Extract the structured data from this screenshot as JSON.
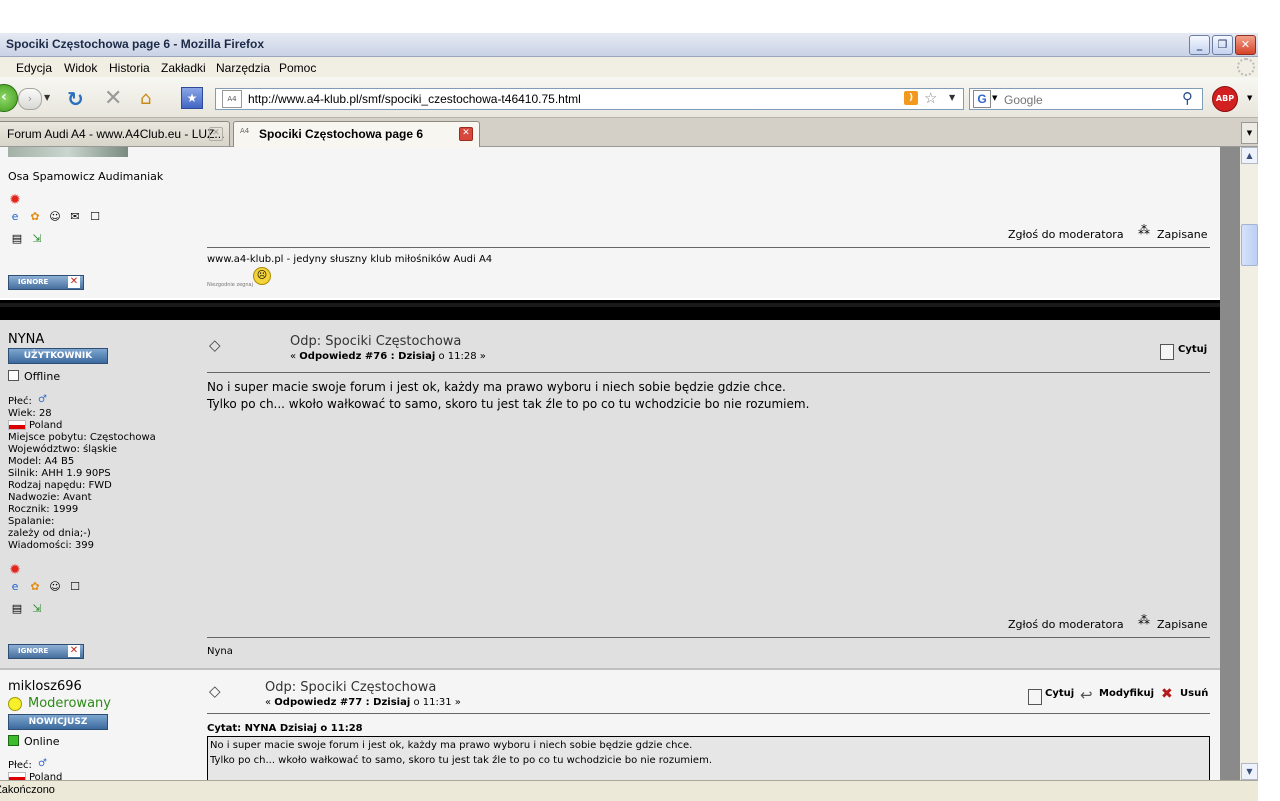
{
  "window": {
    "title": "Spociki Częstochowa page 6 - Mozilla Firefox",
    "min_icon": "_",
    "max_icon": "❐",
    "close_icon": "✕"
  },
  "menu": [
    "Edycja",
    "Widok",
    "Historia",
    "Zakładki",
    "Narzędzia",
    "Pomoc"
  ],
  "nav": {
    "url": "http://www.a4-klub.pl/smf/spociki_czestochowa-t46410.75.html",
    "site_icon_text": "A4",
    "search_engine": "G",
    "search_placeholder": "Google",
    "adblock": "ABP"
  },
  "tabs": [
    {
      "label": "Forum Audi A4 - www.A4Club.eu - LUZ...",
      "close": "✕"
    },
    {
      "label": "Spociki Częstochowa page 6",
      "close": "✕"
    }
  ],
  "status": "Zakończono",
  "posts": {
    "p1": {
      "signature_name": "Osa Spamowicz Audimaniak",
      "report": "Zgłoś do moderatora",
      "saved": "Zapisane",
      "sig_line": "www.a4-klub.pl - jedyny słuszny klub miłośników Audi A4",
      "sig_small": "Niezgodnie zegnaj",
      "ignore": "IGNORE"
    },
    "p2": {
      "username": "NYNA",
      "rank": "UŻYTKOWNIK",
      "status": "Offline",
      "subject": "Odp: Spociki Częstochowa",
      "reply_prefix": "« ",
      "reply_label": "Odpowiedz #76 : Dzisiaj",
      "reply_time": " o 11:28 »",
      "quote_btn": "Cytuj",
      "body_lines": [
        "No i super macie swoje forum i jest ok, każdy ma prawo wyboru i niech sobie będzie gdzie chce.",
        "Tylko po ch... wkoło wałkować to samo, skoro tu jest tak źle to po co tu wchodzicie bo nie rozumiem."
      ],
      "profile": {
        "gender": "Płeć:",
        "age": "Wiek: 28",
        "country": "Poland",
        "place": "Miejsce pobytu: Częstochowa",
        "region": "Województwo: śląskie",
        "model": "Model: A4 B5",
        "engine": "Silnik: AHH 1.9 90PS",
        "drive": "Rodzaj napędu: FWD",
        "body": "Nadwozie: Avant",
        "year": "Rocznik: 1999",
        "burn_label": "Spalanie:",
        "burn_value": "zależy od dnia;-)",
        "messages": "Wiadomości: 399"
      },
      "report": "Zgłoś do moderatora",
      "saved": "Zapisane",
      "signature": "Nyna",
      "ignore": "IGNORE"
    },
    "p3": {
      "username": "miklosz696",
      "moderated": "Moderowany",
      "rank": "NOWICJUSZ",
      "status": "Online",
      "gender": "Płeć:",
      "country": "Poland",
      "subject": "Odp: Spociki Częstochowa",
      "reply_prefix": "« ",
      "reply_label": "Odpowiedz #77 : Dzisiaj",
      "reply_time": " o 11:31 »",
      "quote_btn": "Cytuj",
      "modify_btn": "Modyfikuj",
      "delete_btn": "Usuń",
      "quote_header": "Cytat: NYNA  Dzisiaj o 11:28",
      "quote_lines": [
        "No i super macie swoje forum i jest ok, każdy ma prawo wyboru i niech sobie będzie gdzie chce.",
        "Tylko po ch... wkoło wałkować to samo, skoro tu jest tak źle to po co tu wchodzicie bo nie rozumiem."
      ]
    }
  }
}
